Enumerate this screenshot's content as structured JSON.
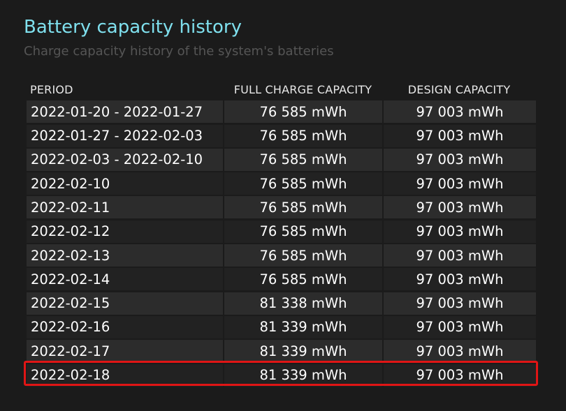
{
  "report": {
    "title": "Battery capacity history",
    "subtitle": "Charge capacity history of the system's batteries"
  },
  "table": {
    "headers": [
      "PERIOD",
      "FULL CHARGE CAPACITY",
      "DESIGN CAPACITY"
    ],
    "rows": [
      {
        "period": "2022-01-20 - 2022-01-27",
        "full": "76 585 mWh",
        "design": "97 003 mWh"
      },
      {
        "period": "2022-01-27 - 2022-02-03",
        "full": "76 585 mWh",
        "design": "97 003 mWh"
      },
      {
        "period": "2022-02-03 - 2022-02-10",
        "full": "76 585 mWh",
        "design": "97 003 mWh"
      },
      {
        "period": "2022-02-10",
        "full": "76 585 mWh",
        "design": "97 003 mWh"
      },
      {
        "period": "2022-02-11",
        "full": "76 585 mWh",
        "design": "97 003 mWh"
      },
      {
        "period": "2022-02-12",
        "full": "76 585 mWh",
        "design": "97 003 mWh"
      },
      {
        "period": "2022-02-13",
        "full": "76 585 mWh",
        "design": "97 003 mWh"
      },
      {
        "period": "2022-02-14",
        "full": "76 585 mWh",
        "design": "97 003 mWh"
      },
      {
        "period": "2022-02-15",
        "full": "81 338 mWh",
        "design": "97 003 mWh"
      },
      {
        "period": "2022-02-16",
        "full": "81 339 mWh",
        "design": "97 003 mWh"
      },
      {
        "period": "2022-02-17",
        "full": "81 339 mWh",
        "design": "97 003 mWh"
      },
      {
        "period": "2022-02-18",
        "full": "81 339 mWh",
        "design": "97 003 mWh"
      }
    ]
  },
  "highlight": {
    "color": "#e01515",
    "row_index": 11
  },
  "colors": {
    "title": "#7fe0ee",
    "subtitle": "#555555",
    "background": "#1b1b1b"
  }
}
